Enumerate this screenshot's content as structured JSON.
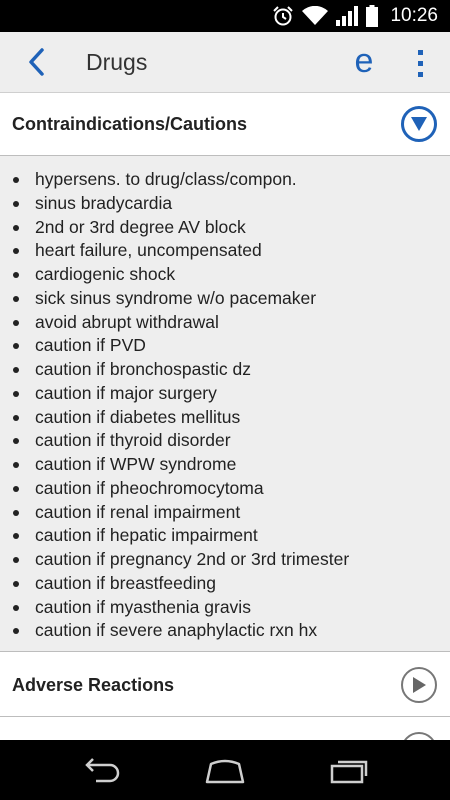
{
  "status_bar": {
    "time": "10:26",
    "icons": [
      "alarm-icon",
      "wifi-icon",
      "signal-icon",
      "battery-icon"
    ]
  },
  "app_bar": {
    "title": "Drugs",
    "back_icon": "chevron-left-icon",
    "logo_letter": "e",
    "menu_icon": "overflow-menu-icon",
    "accent_color": "#1f62b8"
  },
  "sections": {
    "contraindications": {
      "title": "Contraindications/Cautions",
      "expanded": true,
      "items": [
        "hypersens. to drug/class/compon.",
        "sinus bradycardia",
        "2nd or 3rd degree AV block",
        "heart failure, uncompensated",
        "cardiogenic shock",
        "sick sinus syndrome w/o pacemaker",
        "avoid abrupt withdrawal",
        "caution if PVD",
        "caution if bronchospastic dz",
        "caution if major surgery",
        "caution if diabetes mellitus",
        "caution if thyroid disorder",
        "caution if WPW syndrome",
        "caution if pheochromocytoma",
        "caution if renal impairment",
        "caution if hepatic impairment",
        "caution if pregnancy 2nd or 3rd trimester",
        "caution if breastfeeding",
        "caution if myasthenia gravis",
        "caution if severe anaphylactic rxn hx"
      ]
    },
    "adverse_reactions": {
      "title": "Adverse Reactions",
      "expanded": false
    }
  },
  "nav_bar": {
    "buttons": [
      "back-nav-icon",
      "home-nav-icon",
      "recents-nav-icon"
    ]
  }
}
